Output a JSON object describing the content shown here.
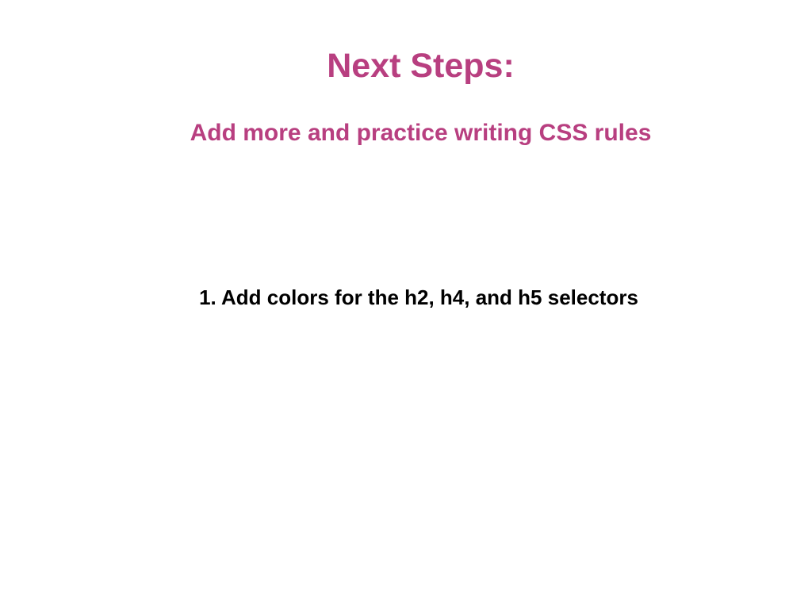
{
  "slide": {
    "title": "Next Steps:",
    "subtitle": "Add more and practice writing CSS rules",
    "steps": [
      "1. Add colors for the h2, h4, and h5 selectors"
    ]
  },
  "colors": {
    "accent": "#b83f80",
    "text": "#000000",
    "background": "#ffffff"
  }
}
